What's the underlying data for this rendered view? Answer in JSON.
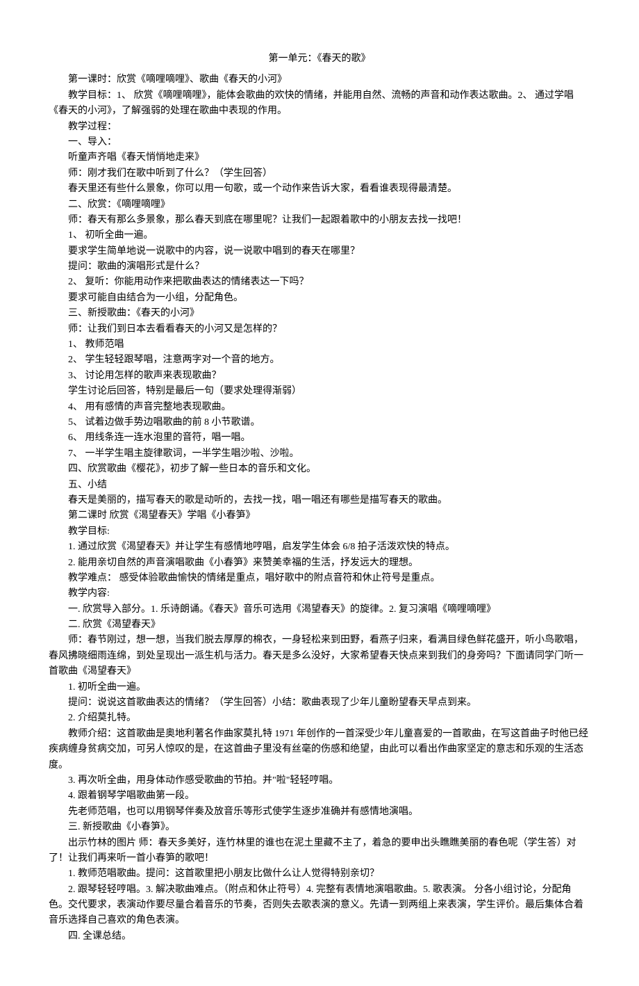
{
  "title": "第一单元：《春天的歌》",
  "p1": "第一课时：欣赏《嘀哩嘀哩》、歌曲《春天的小河》",
  "p2": "教学目标：1、 欣赏《嘀哩嘀哩》，能体会歌曲的欢快的情绪，并能用自然、流畅的声音和动作表达歌曲。2、 通过学唱《春天的小河》，了解强弱的处理在歌曲中表现的作用。",
  "p3": "教学过程：",
  "p4": "一、导入：",
  "p5": "听童声齐唱《春天悄悄地走来》",
  "p6": "师：刚才我们在歌中听到了什么？（学生回答）",
  "p7": "春天里还有些什么景象，你可以用一句歌，或一个动作来告诉大家，看看谁表现得最清楚。",
  "p8": "二、欣赏：《嘀哩嘀哩》",
  "p9": "师：春天有那么多景象，那么春天到底在哪里呢？让我们一起跟着歌中的小朋友去找一找吧！",
  "p10": "1、 初听全曲一遍。",
  "p11": "要求学生简单地说一说歌中的内容，说一说歌中唱到的春天在哪里？",
  "p12": "提问：歌曲的演唱形式是什么？",
  "p13": "2、 复听：你能用动作来把歌曲表达的情绪表达一下吗？",
  "p14": "要求可能自由结合为一小组，分配角色。",
  "p15": "三、新授歌曲：《春天的小河》",
  "p16": "师：让我们到日本去看看春天的小河又是怎样的？",
  "p17": "1、 教师范唱",
  "p18": "2、 学生轻轻跟琴唱，注意两字对一个音的地方。",
  "p19": "3、 讨论用怎样的歌声来表现歌曲？",
  "p20": "学生讨论后回答，特别是最后一句（要求处理得渐弱）",
  "p21": "4、 用有感情的声音完整地表现歌曲。",
  "p22": "5、 试着边做手势边唱歌曲的前 8 小节歌谱。",
  "p23": "6、 用线条连一连水泡里的音符，唱一唱。",
  "p24": "7、 一半学生唱主旋律歌词，一半学生唱沙啦、沙啦。",
  "p25": "四、欣赏歌曲《樱花》，初步了解一些日本的音乐和文化。",
  "p26": "五、小结",
  "p27": "春天是美丽的，描写春天的歌是动听的，去找一找，唱一唱还有哪些是描写春天的歌曲。",
  "p28": "第二课时 欣赏《渴望春天》学唱《小春笋》",
  "p29": "教学目标:",
  "p30": "1.  通过欣赏《渴望春天》并让学生有感情地哼唱，启发学生体会 6/8 拍子活泼欢快的特点。",
  "p31": "2.  能用亲切自然的声音演唱歌曲《小春笋》来赞美幸福的生活，抒发远大的理想。",
  "p32": "教学难点： 感受体验歌曲愉快的情绪是重点，唱好歌中的附点音符和休止符号是重点。",
  "p33": "教学内容:",
  "p34": "一.  欣赏导入部分。1.  乐诗朗诵。《春天》音乐可选用《渴望春天》的旋律。2.  复习演唱《嘀哩嘀哩》",
  "p35": "二. 欣赏《渴望春天》",
  "p36": "师：春节刚过，想一想，当我们脱去厚厚的棉衣，一身轻松来到田野，看燕子归来，看满目绿色鲜花盛开，听小鸟歌唱，春风拂晓细雨连绵，到处呈现出一派生机与活力。春天是多么没好，大家希望春天快点来到我们的身旁吗？下面请同学门听一首歌曲《渴望春天》",
  "p37": "1.  初听全曲一遍。",
  "p38": "提问：说说这首歌曲表达的情绪？（学生回答）小结：歌曲表现了少年儿童盼望春天早点到来。",
  "p39": "2.  介绍莫扎特。",
  "p40": "教师介绍：这首歌曲是奥地利著名作曲家莫扎特 1971 年创作的一首深受少年儿童喜爱的一首歌曲，在写这首曲子时他已经疾病缠身贫病交加，可另人惊叹的是，在这首曲子里没有丝毫的伤感和绝望，由此可以看出作曲家坚定的意志和乐观的生活态度。",
  "p41": "3.  再次听全曲，用身体动作感受歌曲的节拍。并\"啦\"轻轻哼唱。",
  "p42": "4.  跟着钢琴学唱歌曲第一段。",
  "p43": "先老师范唱，也可以用钢琴伴奏及放音乐等形式使学生逐步准确并有感情地演唱。",
  "p44": "三. 新授歌曲《小春笋》。",
  "p45": "出示竹林的图片 师：春天多美好，连竹林里的谁也在泥土里藏不主了，着急的要申出头瞧瞧美丽的春色呢（学生答）对了！让我们再来听一首小春笋的歌吧！",
  "p46": "1.  教师范唱歌曲。提问：这首歌里把小朋友比做什么让人觉得特别亲切？",
  "p47": "2.  跟琴轻轻哼唱。3.  解决歌曲难点。（附点和休止符号）4.  完整有表情地演唱歌曲。5.  歌表演。 分各小组讨论，分配角色。交代要求，表演动作要尽量合着音乐的节奏，否则失去歌表演的意义。先请一到两组上来表演，学生评价。最后集体合着音乐选择自己喜欢的角色表演。",
  "p48": "四. 全课总结。"
}
